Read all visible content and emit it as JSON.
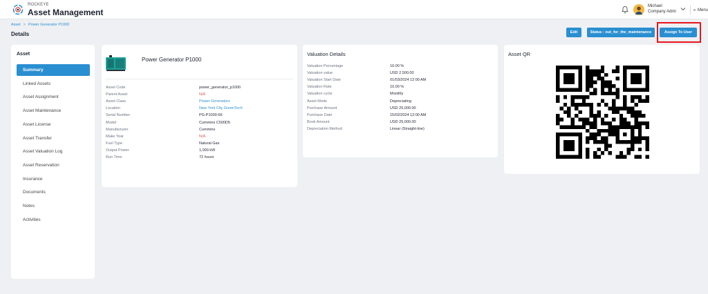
{
  "app": {
    "brand_small": "ROCKEYE",
    "title": "Asset Management"
  },
  "user": {
    "name": "Michael",
    "role": "Company Admi"
  },
  "menu": {
    "label": "Menu"
  },
  "breadcrumb": [
    "Asset",
    "Power Generator P1000"
  ],
  "page": {
    "title": "Details"
  },
  "actions": {
    "edit": "Edit",
    "status": "Status : out_for_the_maintenance",
    "assign": "Assign To User"
  },
  "sidebar": {
    "heading": "Asset",
    "items": [
      "Summary",
      "Linked Assets",
      "Asset Assignment",
      "Asset Maintenance",
      "Asset License",
      "Asset Transfer",
      "Asset Valuation Log",
      "Asset Reservation",
      "Insurance",
      "Documents",
      "Notes",
      "Activities"
    ],
    "active": "Summary"
  },
  "asset": {
    "name": "Power Generator P1000",
    "fields": [
      {
        "label": "Asset Code",
        "value": "power_generator_p1000",
        "kind": "text"
      },
      {
        "label": "Parent Asset",
        "value": "N/A",
        "kind": "na"
      },
      {
        "label": "Asset Class",
        "value": "Power Generators",
        "kind": "link"
      },
      {
        "label": "Location",
        "value": "New York City GreenTech",
        "kind": "link"
      },
      {
        "label": "Serial Number",
        "value": "PG-P1000-66",
        "kind": "text"
      },
      {
        "label": "Model",
        "value": "Cummins C500D5",
        "kind": "text"
      },
      {
        "label": "Manufacturer",
        "value": "Cummins",
        "kind": "text"
      },
      {
        "label": "Make Year",
        "value": "N/A",
        "kind": "na"
      },
      {
        "label": "Fuel Type",
        "value": "Natural Gas",
        "kind": "text"
      },
      {
        "label": "Output Power",
        "value": "1,000 kW",
        "kind": "text"
      },
      {
        "label": "Run Time",
        "value": "72 hours",
        "kind": "text"
      }
    ]
  },
  "valuation": {
    "title": "Valuation Details",
    "fields": [
      {
        "label": "Valuation Percentage",
        "value": "10.00 %"
      },
      {
        "label": "Valuation value",
        "value": "USD 2,500.00"
      },
      {
        "label": "Valuation Start Date",
        "value": "01/03/2024 12:00 AM"
      },
      {
        "label": "Valuation Rate",
        "value": "10.00 %"
      },
      {
        "label": "Valuation cycle",
        "value": "Monthly"
      },
      {
        "label": "Asset Mode",
        "value": "Depreciating"
      },
      {
        "label": "Purchase Amount",
        "value": "USD 25,000.00"
      },
      {
        "label": "Purchase Date",
        "value": "15/02/2024 12:00 AM"
      },
      {
        "label": "Book Amount",
        "value": "USD 25,000.00"
      },
      {
        "label": "Depreciation Method",
        "value": "Linear (Straight-line)"
      }
    ]
  },
  "qr": {
    "title": "Asset QR"
  },
  "colors": {
    "primary": "#2a8fd1",
    "na": "#e0574f",
    "highlight": "#e8141a"
  },
  "icons": {
    "logo": "rockeye-logo-icon",
    "bell": "bell-icon",
    "avatar": "user-avatar-icon",
    "menu": "hamburger-icon"
  }
}
